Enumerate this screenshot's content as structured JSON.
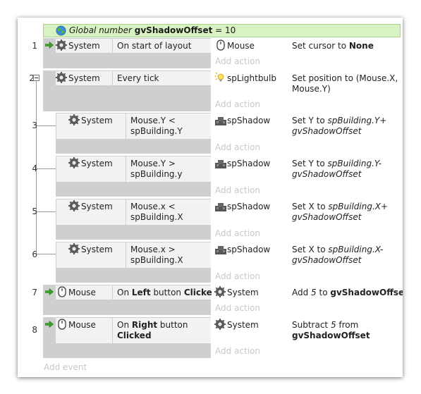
{
  "global_var": {
    "prefix": "Global number",
    "name": "gvShadowOffset",
    "suffix": "= 10"
  },
  "add_action_label": "Add action",
  "add_event_label": "Add event",
  "events": [
    {
      "number": "1",
      "condition_object": "System",
      "condition_text": "On start of layout",
      "action_object": "Mouse",
      "action_text_parts": [
        "Set cursor to ",
        "None"
      ]
    },
    {
      "number": "2",
      "condition_object": "System",
      "condition_text": "Every tick",
      "action_object": "spLightbulb",
      "action_text_line1": "Set position to (Mouse.X,",
      "action_text_line2": "Mouse.Y)"
    },
    {
      "number": "3",
      "condition_object": "System",
      "condition_line1": "Mouse.Y <",
      "condition_line2": "spBuilding.Y",
      "action_object": "spShadow",
      "action_line1_plain": "Set Y to ",
      "action_line1_italic": "spBuilding.Y+",
      "action_line2_italic": "gvShadowOffset"
    },
    {
      "number": "4",
      "condition_object": "System",
      "condition_line1": "Mouse.Y >",
      "condition_line2": "spBuilding.y",
      "action_object": "spShadow",
      "action_line1_plain": "Set Y to ",
      "action_line1_italic": "spBuilding.Y-",
      "action_line2_italic": "gvShadowOffset"
    },
    {
      "number": "5",
      "condition_object": "System",
      "condition_line1": "Mouse.x <",
      "condition_line2": "spBuilding.X",
      "action_object": "spShadow",
      "action_line1_plain": "Set X to ",
      "action_line1_italic": "spBuilding.X+",
      "action_line2_italic": "gvShadowOffset"
    },
    {
      "number": "6",
      "condition_object": "System",
      "condition_line1": "Mouse.x >",
      "condition_line2": "spBuilding.X",
      "action_object": "spShadow",
      "action_line1_plain": "Set X to ",
      "action_line1_italic": "spBuilding.X-",
      "action_line2_italic": "gvShadowOffset"
    },
    {
      "number": "7",
      "condition_object": "Mouse",
      "condition_pre": "On ",
      "condition_bold": "Left",
      "condition_mid": " button ",
      "condition_bold2": "Clicked",
      "action_object": "System",
      "action_pre": "Add ",
      "action_italic": "5",
      "action_mid": " to ",
      "action_bold": "gvShadowOffset"
    },
    {
      "number": "8",
      "condition_object": "Mouse",
      "condition_pre": "On ",
      "condition_bold": "Right",
      "condition_mid": " button",
      "condition_bold2": "Clicked",
      "action_object": "System",
      "action_pre": "Subtract ",
      "action_italic": "5",
      "action_mid": " from",
      "action_bold": "gvShadowOffset"
    }
  ],
  "colors": {
    "global_bg": "#d9f2c2",
    "condition_bg": "#f2f2f2",
    "gap_bg": "#cfcfcf",
    "trigger_arrow": "#3aa02a"
  }
}
